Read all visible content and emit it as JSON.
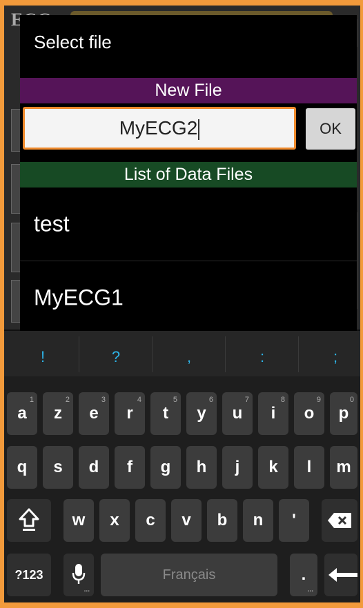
{
  "dialog": {
    "title": "Select file",
    "new_file_header": "New File",
    "filename_value": "MyECG2",
    "ok_label": "OK",
    "list_header": "List of Data Files",
    "files": [
      "test",
      "MyECG1"
    ]
  },
  "keyboard": {
    "suggestions": [
      "!",
      "?",
      ",",
      ":",
      ";"
    ],
    "row1": [
      {
        "k": "a",
        "h": "1"
      },
      {
        "k": "z",
        "h": "2"
      },
      {
        "k": "e",
        "h": "3"
      },
      {
        "k": "r",
        "h": "4"
      },
      {
        "k": "t",
        "h": "5"
      },
      {
        "k": "y",
        "h": "6"
      },
      {
        "k": "u",
        "h": "7"
      },
      {
        "k": "i",
        "h": "8"
      },
      {
        "k": "o",
        "h": "9"
      },
      {
        "k": "p",
        "h": "0"
      }
    ],
    "row2": [
      "q",
      "s",
      "d",
      "f",
      "g",
      "h",
      "j",
      "k",
      "l",
      "m"
    ],
    "row3": [
      "w",
      "x",
      "c",
      "v",
      "b",
      "n",
      "'"
    ],
    "symbols_label": "?123",
    "space_label": "Français",
    "period_label": "."
  },
  "background_app": {
    "logo_text": "ECG"
  },
  "colors": {
    "frame": "#f29a3b",
    "new_file_header": "#551458",
    "list_header": "#174a24",
    "input_border": "#f08a2c",
    "suggestion_text": "#2db4e8"
  },
  "icons": [
    "shift-icon",
    "backspace-icon",
    "microphone-icon",
    "enter-icon"
  ]
}
